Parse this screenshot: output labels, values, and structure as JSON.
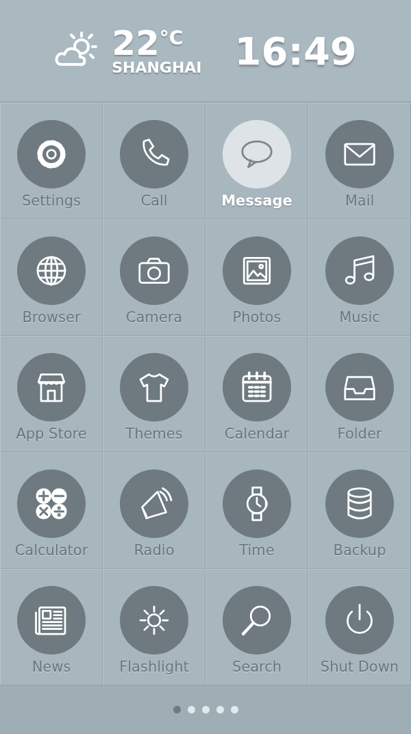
{
  "header": {
    "temperature": "22",
    "unit": "°C",
    "city": "SHANGHAI",
    "time": "16:49"
  },
  "apps": [
    {
      "label": "Settings",
      "selected": false
    },
    {
      "label": "Call",
      "selected": false
    },
    {
      "label": "Message",
      "selected": true
    },
    {
      "label": "Mail",
      "selected": false
    },
    {
      "label": "Browser",
      "selected": false
    },
    {
      "label": "Camera",
      "selected": false
    },
    {
      "label": "Photos",
      "selected": false
    },
    {
      "label": "Music",
      "selected": false
    },
    {
      "label": "App Store",
      "selected": false
    },
    {
      "label": "Themes",
      "selected": false
    },
    {
      "label": "Calendar",
      "selected": false
    },
    {
      "label": "Folder",
      "selected": false
    },
    {
      "label": "Calculator",
      "selected": false
    },
    {
      "label": "Radio",
      "selected": false
    },
    {
      "label": "Time",
      "selected": false
    },
    {
      "label": "Backup",
      "selected": false
    },
    {
      "label": "News",
      "selected": false
    },
    {
      "label": "Flashlight",
      "selected": false
    },
    {
      "label": "Search",
      "selected": false
    },
    {
      "label": "Shut Down",
      "selected": false
    }
  ],
  "pages": [
    {
      "selected": true
    },
    {
      "selected": false
    },
    {
      "selected": false
    },
    {
      "selected": false
    },
    {
      "selected": false
    }
  ]
}
